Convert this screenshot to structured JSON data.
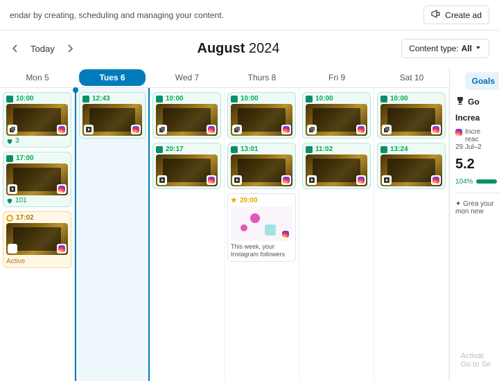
{
  "topbar": {
    "subtitle": "endar by creating, scheduling and managing your content.",
    "create_ad": "Create ad"
  },
  "nav": {
    "today": "Today",
    "month": "August",
    "year": "2024",
    "filter_label": "Content type:",
    "filter_value": "All"
  },
  "days": [
    {
      "label": "Mon 5",
      "active": false
    },
    {
      "label": "Tues 6",
      "active": true
    },
    {
      "label": "Wed 7",
      "active": false
    },
    {
      "label": "Thurs 8",
      "active": false
    },
    {
      "label": "Fri 9",
      "active": false
    },
    {
      "label": "Sat 10",
      "active": false
    }
  ],
  "columns": [
    [
      {
        "kind": "post",
        "variant": "teal",
        "time": "10:00",
        "icon": "stack",
        "likes": "3"
      },
      {
        "kind": "post",
        "variant": "teal",
        "time": "17:00",
        "icon": "reel",
        "likes": "101"
      },
      {
        "kind": "post",
        "variant": "yellow",
        "time": "17:02",
        "icon": "clock",
        "status": "Active"
      }
    ],
    [
      {
        "kind": "post",
        "variant": "teal",
        "time": "12:43",
        "icon": "reel"
      }
    ],
    [
      {
        "kind": "post",
        "variant": "teal",
        "time": "10:00",
        "icon": "stack"
      },
      {
        "kind": "post",
        "variant": "teal",
        "time": "20:17",
        "icon": "reel"
      }
    ],
    [
      {
        "kind": "post",
        "variant": "teal",
        "time": "10:00",
        "icon": "stack"
      },
      {
        "kind": "post",
        "variant": "teal",
        "time": "13:01",
        "icon": "reel"
      },
      {
        "kind": "special",
        "time": "20:00",
        "text": "This week, your Instagram followers"
      }
    ],
    [
      {
        "kind": "post",
        "variant": "teal",
        "time": "10:00",
        "icon": "stack"
      },
      {
        "kind": "post",
        "variant": "teal",
        "time": "11:02",
        "icon": "reel"
      }
    ],
    [
      {
        "kind": "post",
        "variant": "teal",
        "time": "10:00",
        "icon": "stack"
      },
      {
        "kind": "post",
        "variant": "teal",
        "time": "13:24",
        "icon": "reel"
      }
    ]
  ],
  "sidebar": {
    "goals_tab": "Goals",
    "head": "Go",
    "sub": "Increa",
    "line1": "Incre",
    "line2": "reac",
    "date": "29 Jul–2",
    "big": "5.2",
    "pct": "104%",
    "tip": "Grea your mon new"
  },
  "watermark": {
    "l1": "Activat",
    "l2": "Go to Se"
  }
}
